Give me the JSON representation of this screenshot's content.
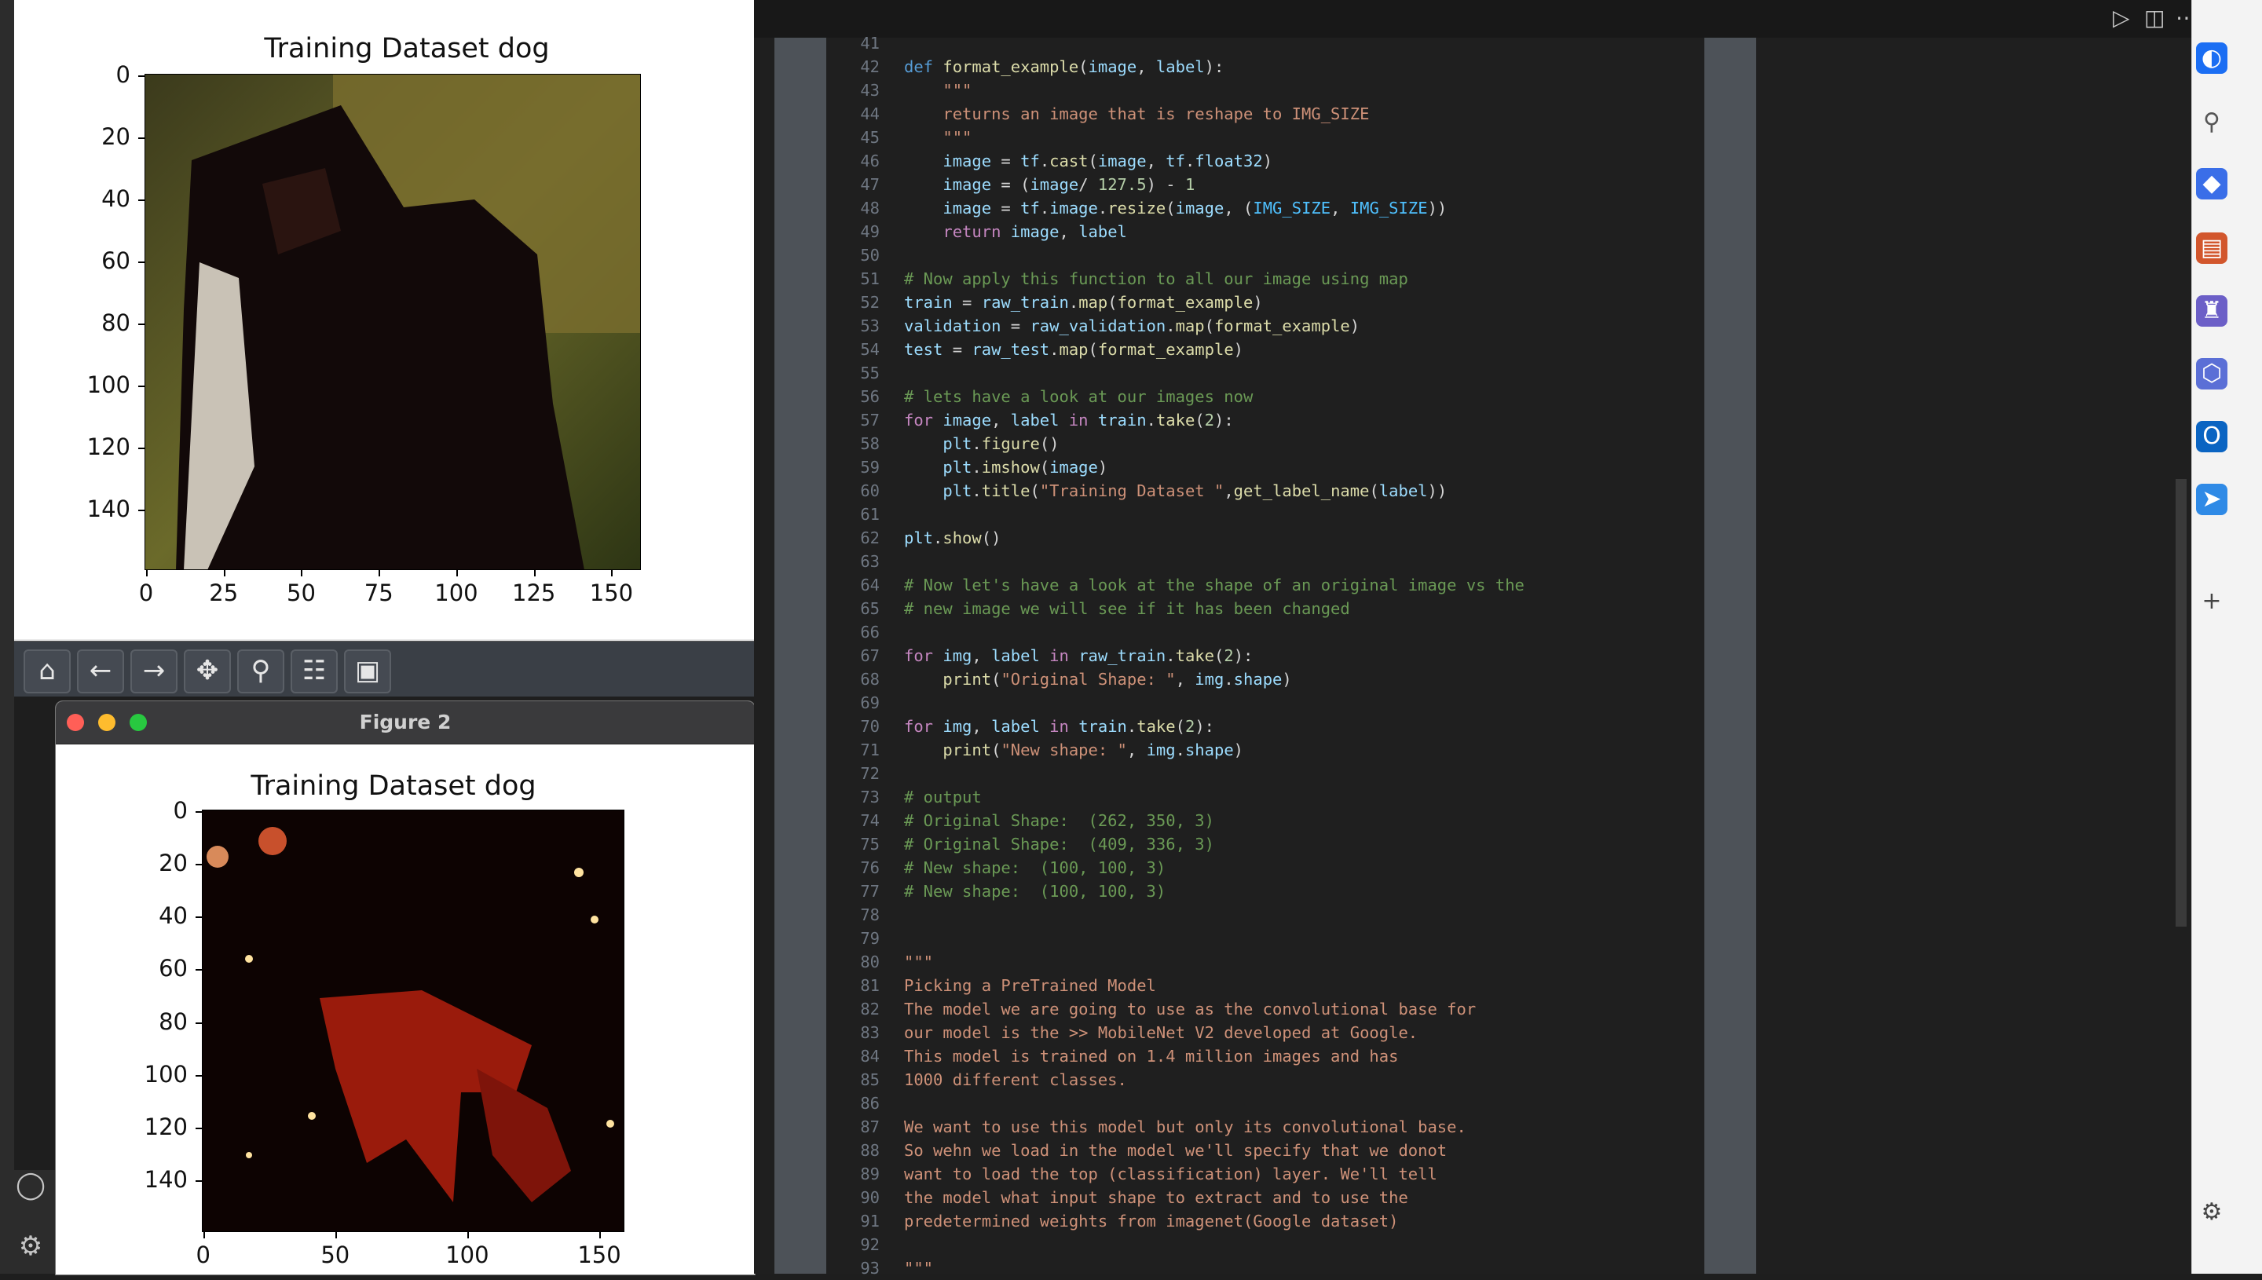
{
  "figure1": {
    "plot_title": "Training Dataset dog",
    "y_ticks": [
      "0",
      "20",
      "40",
      "60",
      "80",
      "100",
      "120",
      "140"
    ],
    "x_ticks": [
      "0",
      "25",
      "50",
      "75",
      "100",
      "125",
      "150"
    ],
    "toolbar": [
      {
        "name": "home-icon",
        "glyph": "⌂"
      },
      {
        "name": "back-icon",
        "glyph": "←"
      },
      {
        "name": "forward-icon",
        "glyph": "→"
      },
      {
        "name": "pan-icon",
        "glyph": "✥"
      },
      {
        "name": "zoom-icon",
        "glyph": "⚲"
      },
      {
        "name": "configure-icon",
        "glyph": "☷"
      },
      {
        "name": "save-icon",
        "glyph": "▣"
      }
    ]
  },
  "figure2": {
    "window_title": "Figure 2",
    "plot_title": "Training Dataset dog",
    "y_ticks": [
      "0",
      "20",
      "40",
      "60",
      "80",
      "100",
      "120",
      "140"
    ],
    "x_ticks": [
      "0",
      "50",
      "100",
      "150"
    ]
  },
  "editor": {
    "lines": [
      {
        "n": "41",
        "t": ""
      },
      {
        "n": "42",
        "t": "def format_example(image, label):"
      },
      {
        "n": "43",
        "t": "    \"\"\""
      },
      {
        "n": "44",
        "t": "    returns an image that is reshape to IMG_SIZE"
      },
      {
        "n": "45",
        "t": "    \"\"\""
      },
      {
        "n": "46",
        "t": "    image = tf.cast(image, tf.float32)"
      },
      {
        "n": "47",
        "t": "    image = (image/ 127.5) - 1"
      },
      {
        "n": "48",
        "t": "    image = tf.image.resize(image, (IMG_SIZE, IMG_SIZE))"
      },
      {
        "n": "49",
        "t": "    return image, label"
      },
      {
        "n": "50",
        "t": ""
      },
      {
        "n": "51",
        "t": "# Now apply this function to all our image using map"
      },
      {
        "n": "52",
        "t": "train = raw_train.map(format_example)"
      },
      {
        "n": "53",
        "t": "validation = raw_validation.map(format_example)"
      },
      {
        "n": "54",
        "t": "test = raw_test.map(format_example)"
      },
      {
        "n": "55",
        "t": ""
      },
      {
        "n": "56",
        "t": "# lets have a look at our images now"
      },
      {
        "n": "57",
        "t": "for image, label in train.take(2):"
      },
      {
        "n": "58",
        "t": "    plt.figure()"
      },
      {
        "n": "59",
        "t": "    plt.imshow(image)"
      },
      {
        "n": "60",
        "t": "    plt.title(\"Training Dataset \",get_label_name(label))"
      },
      {
        "n": "61",
        "t": ""
      },
      {
        "n": "62",
        "t": "plt.show()"
      },
      {
        "n": "63",
        "t": ""
      },
      {
        "n": "64",
        "t": "# Now let's have a look at the shape of an original image vs the"
      },
      {
        "n": "65",
        "t": "# new image we will see if it has been changed"
      },
      {
        "n": "66",
        "t": ""
      },
      {
        "n": "67",
        "t": "for img, label in raw_train.take(2):"
      },
      {
        "n": "68",
        "t": "    print(\"Original Shape: \", img.shape)"
      },
      {
        "n": "69",
        "t": ""
      },
      {
        "n": "70",
        "t": "for img, label in train.take(2):"
      },
      {
        "n": "71",
        "t": "    print(\"New shape: \", img.shape)"
      },
      {
        "n": "72",
        "t": ""
      },
      {
        "n": "73",
        "t": "# output"
      },
      {
        "n": "74",
        "t": "# Original Shape:  (262, 350, 3)"
      },
      {
        "n": "75",
        "t": "# Original Shape:  (409, 336, 3)"
      },
      {
        "n": "76",
        "t": "# New shape:  (100, 100, 3)"
      },
      {
        "n": "77",
        "t": "# New shape:  (100, 100, 3)"
      },
      {
        "n": "78",
        "t": ""
      },
      {
        "n": "79",
        "t": ""
      },
      {
        "n": "80",
        "t": "\"\"\""
      },
      {
        "n": "81",
        "t": "Picking a PreTrained Model"
      },
      {
        "n": "82",
        "t": "The model we are going to use as the convolutional base for"
      },
      {
        "n": "83",
        "t": "our model is the >> MobileNet V2 developed at Google."
      },
      {
        "n": "84",
        "t": "This model is trained on 1.4 million images and has"
      },
      {
        "n": "85",
        "t": "1000 different classes."
      },
      {
        "n": "86",
        "t": ""
      },
      {
        "n": "87",
        "t": "We want to use this model but only its convolutional base."
      },
      {
        "n": "88",
        "t": "So wehn we load in the model we'll specify that we donot"
      },
      {
        "n": "89",
        "t": "want to load the top (classification) layer. We'll tell"
      },
      {
        "n": "90",
        "t": "the model what input shape to extract and to use the"
      },
      {
        "n": "91",
        "t": "predetermined weights from imagenet(Google dataset)"
      },
      {
        "n": "92",
        "t": ""
      },
      {
        "n": "93",
        "t": "\"\"\""
      }
    ],
    "colors": {
      "keyword": "#c586c0",
      "def": "#569cd6",
      "func": "#dcdcaa",
      "var": "#9cdcfe",
      "string": "#ce9178",
      "comment": "#6a9955",
      "number": "#b5cea8",
      "constant": "#4fc1ff",
      "plain": "#d4d4d4"
    }
  }
}
